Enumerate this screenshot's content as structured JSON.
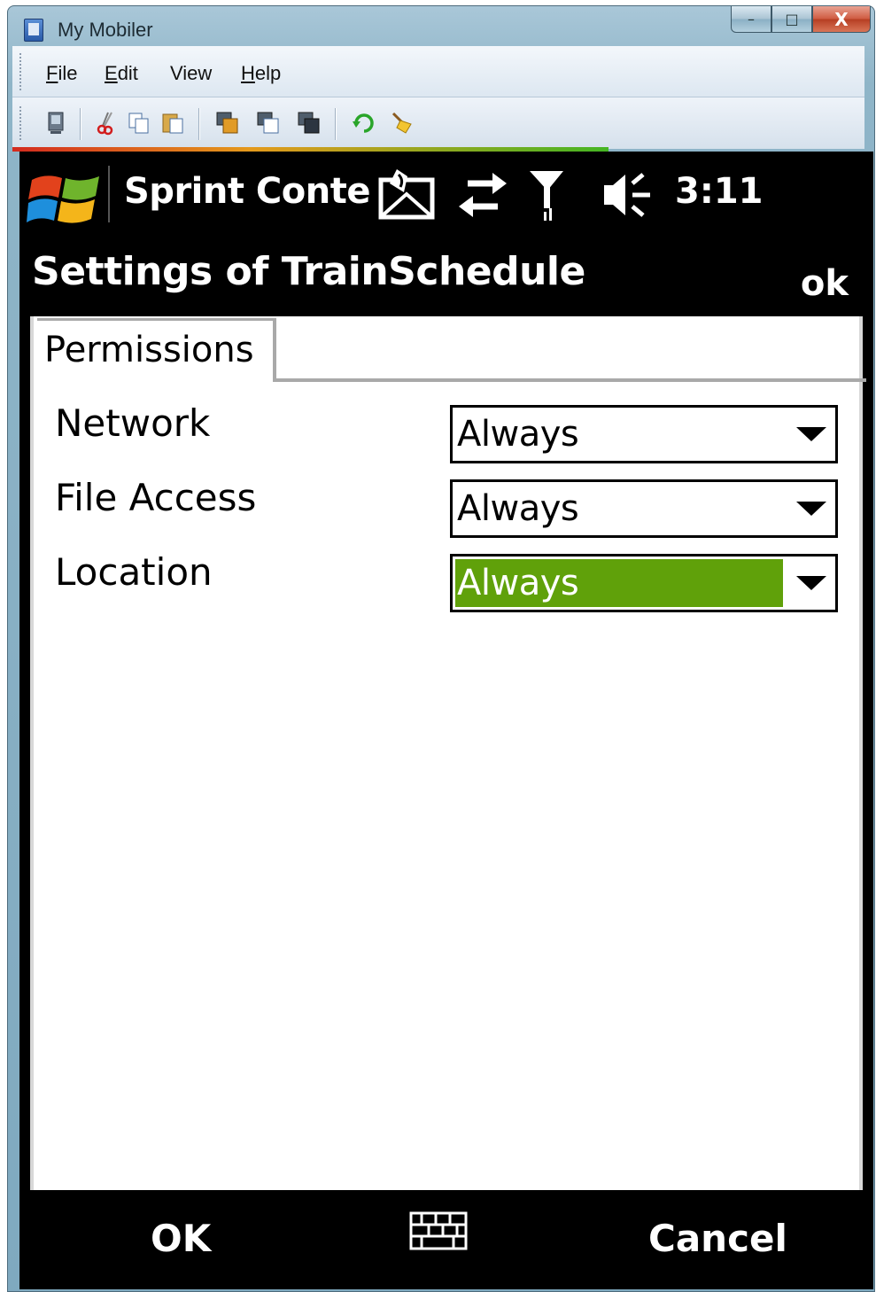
{
  "window": {
    "title": "My Mobiler",
    "caption": {
      "minimize": "–",
      "maximize": "□",
      "close": "X"
    }
  },
  "menubar": {
    "items": [
      {
        "label": "File",
        "mnemonic": "F",
        "rest": "ile"
      },
      {
        "label": "Edit",
        "mnemonic": "E",
        "rest": "dit"
      },
      {
        "label": "View",
        "mnemonic": "",
        "rest": "View"
      },
      {
        "label": "Help",
        "mnemonic": "H",
        "rest": "elp"
      }
    ]
  },
  "toolbar": {
    "icons": [
      "device-icon",
      "cut-icon",
      "copy-icon",
      "paste-icon",
      "screen-copy-icon",
      "screen-paste-icon",
      "screen-capture-icon",
      "refresh-icon",
      "clean-icon"
    ]
  },
  "status": {
    "carrier": "Sprint Conte",
    "clock": "3:11",
    "icons": [
      "message-icon",
      "data-sync-icon",
      "signal-icon",
      "speaker-icon"
    ]
  },
  "app": {
    "title": "Settings of TrainSchedule",
    "ok_label": "ok"
  },
  "tabs": [
    {
      "label": "Permissions",
      "active": true
    }
  ],
  "settings": [
    {
      "label": "Network",
      "value": "Always",
      "focused": false
    },
    {
      "label": "File Access",
      "value": "Always",
      "focused": false
    },
    {
      "label": "Location",
      "value": "Always",
      "focused": true
    }
  ],
  "softkeys": {
    "left": "OK",
    "right": "Cancel"
  },
  "colors": {
    "focus": "#60a10a",
    "screen_bg": "#000000"
  }
}
